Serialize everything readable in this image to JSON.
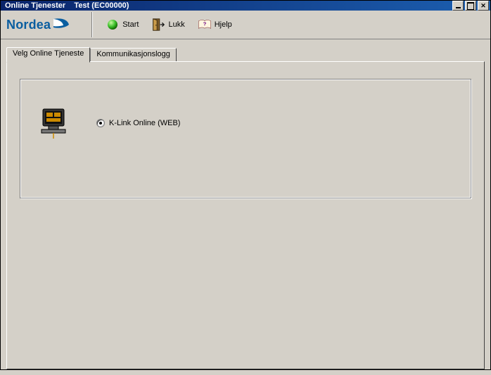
{
  "window": {
    "title": "Online Tjenester    Test (EC00000)"
  },
  "brand": {
    "name": "Nordea"
  },
  "toolbar": {
    "start_label": "Start",
    "lukk_label": "Lukk",
    "hjelp_label": "Hjelp"
  },
  "tabs": {
    "select_service": "Velg Online Tjeneste",
    "comm_log": "Kommunikasjonslogg"
  },
  "options": {
    "klink_online": "K-Link Online  (WEB)"
  }
}
